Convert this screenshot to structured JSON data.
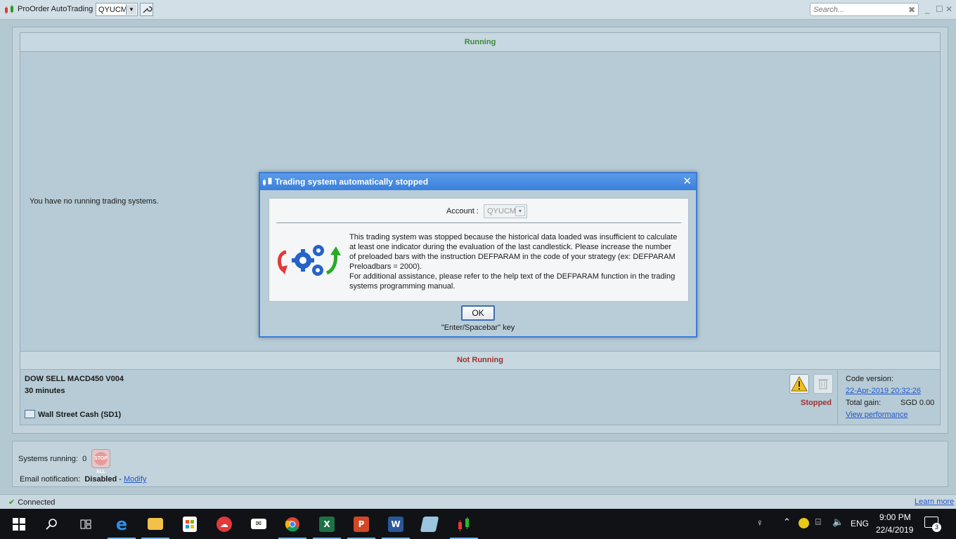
{
  "app": {
    "title": "ProOrder AutoTrading",
    "account": "QYUCM",
    "search_placeholder": "Search..."
  },
  "running": {
    "header": "Running",
    "empty_text": "You have no running trading systems."
  },
  "not_running": {
    "header": "Not Running",
    "system": {
      "name": "DOW SELL MACD450 V004",
      "timeframe": "30 minutes",
      "instrument": "Wall Street Cash (SD1)",
      "status": "Stopped",
      "code_version_label": "Code version:",
      "code_version": "22-Apr-2019 20:32:26",
      "total_gain_label": "Total gain:",
      "total_gain": "SGD 0.00",
      "view_performance": "View performance"
    }
  },
  "bottom": {
    "systems_running_label": "Systems running:",
    "systems_running_count": "0",
    "stop_all_label": "STOP ALL",
    "email_label": "Email notification:",
    "email_status": "Disabled",
    "email_separator": "-",
    "email_modify": "Modify"
  },
  "statusbar": {
    "connection": "Connected",
    "learn_more": "Learn more"
  },
  "dialog": {
    "title": "Trading system automatically stopped",
    "account_label": "Account :",
    "account": "QYUCM",
    "message": "This trading system was stopped because the historical data loaded was insufficient to calculate at least one indicator during the evaluation of the last candlestick. Please increase the number of preloaded bars with the instruction DEFPARAM in the code of your strategy (ex: DEFPARAM Preloadbars = 2000).\nFor additional assistance, please refer to the help text of the DEFPARAM function in the trading systems programming manual.",
    "ok_label": "OK",
    "key_hint": "\"Enter/Spacebar\" key"
  },
  "taskbar": {
    "language": "ENG",
    "time": "9:00 PM",
    "date": "22/4/2019",
    "notification_count": "3",
    "apps": [
      "start-icon",
      "search-icon",
      "task-view-icon",
      "edge-icon",
      "file-explorer-icon",
      "store-icon",
      "cloud-app-icon",
      "mail-icon",
      "chrome-icon",
      "excel-icon",
      "powerpoint-icon",
      "word-icon",
      "notes-icon",
      "prorealtime-icon"
    ]
  },
  "colors": {
    "running_green": "#3a8a3a",
    "stopped_red": "#a03030",
    "link_blue": "#2255cc",
    "dialog_title_blue": "#3a7fdc"
  }
}
